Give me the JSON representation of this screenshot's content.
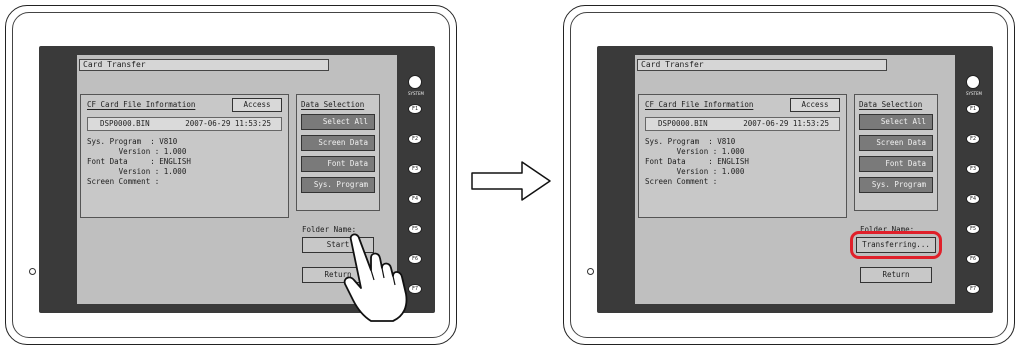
{
  "panels": [
    {
      "title": "Card Transfer",
      "info_title": "CF Card File Information",
      "access_label": "Access",
      "file_name": "DSP0000.BIN",
      "file_date": "2007-06-29 11:53:25",
      "details": [
        "Sys. Program  : V810",
        "       Version : 1.000",
        "Font Data     : ENGLISH",
        "       Version : 1.000",
        "Screen Comment :"
      ],
      "data_selection_title": "Data Selection",
      "data_buttons": [
        "Select All",
        "Screen Data",
        "Font Data",
        "Sys. Program"
      ],
      "folder_label": "Folder Name:",
      "action_label": "Start",
      "return_label": "Return"
    },
    {
      "title": "Card Transfer",
      "info_title": "CF Card File Information",
      "access_label": "Access",
      "file_name": "DSP0000.BIN",
      "file_date": "2007-06-29 11:53:25",
      "details": [
        "Sys. Program  : V810",
        "       Version : 1.000",
        "Font Data     : ENGLISH",
        "       Version : 1.000",
        "Screen Comment :"
      ],
      "data_selection_title": "Data Selection",
      "data_buttons": [
        "Select All",
        "Screen Data",
        "Font Data",
        "Sys. Program"
      ],
      "folder_label": "Folder Name:",
      "action_label": "Transferring...",
      "return_label": "Return"
    }
  ],
  "function_keys": [
    "F1",
    "F2",
    "F3",
    "F4",
    "F5",
    "F6",
    "F7"
  ],
  "system_key_label": "SYSTEM",
  "colors": {
    "highlight": "#e0202a",
    "lcd": "#bfbfbf",
    "bezel": "#3a3a3a"
  },
  "icons": [
    "right-arrow-icon",
    "pointing-hand-icon"
  ]
}
